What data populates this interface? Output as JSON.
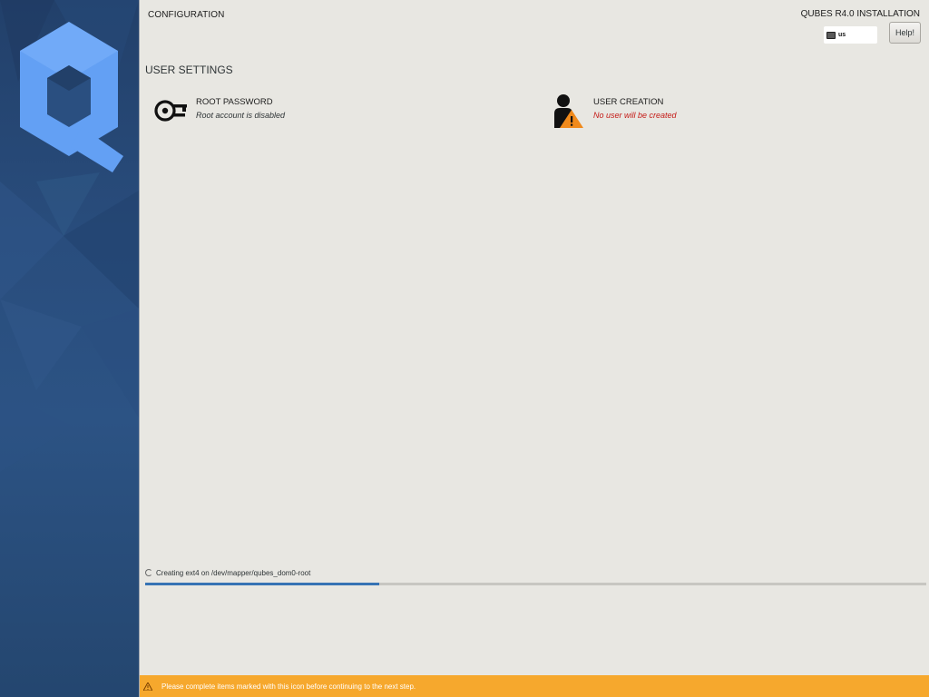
{
  "header": {
    "config_title": "CONFIGURATION",
    "product_title": "QUBES R4.0 INSTALLATION",
    "keyboard_layout": "us",
    "help_label": "Help!"
  },
  "section": {
    "title": "USER SETTINGS"
  },
  "spokes": [
    {
      "title": "ROOT PASSWORD",
      "status": "Root account is disabled",
      "icon": "key-icon"
    },
    {
      "title": "USER CREATION",
      "status": "No user will be created",
      "icon": "user-warning-icon"
    }
  ],
  "progress": {
    "text": "Creating ext4 on /dev/mapper/qubes_dom0-root",
    "value": 0.3
  },
  "warning_bar": {
    "text": "Please complete items marked with this icon before continuing to the next step."
  },
  "colors": {
    "sidebar": "#2a4f80",
    "logo": "#63a0f4",
    "warning": "#f6a82d",
    "progress": "#3673b4",
    "error_text": "#c41a16"
  }
}
